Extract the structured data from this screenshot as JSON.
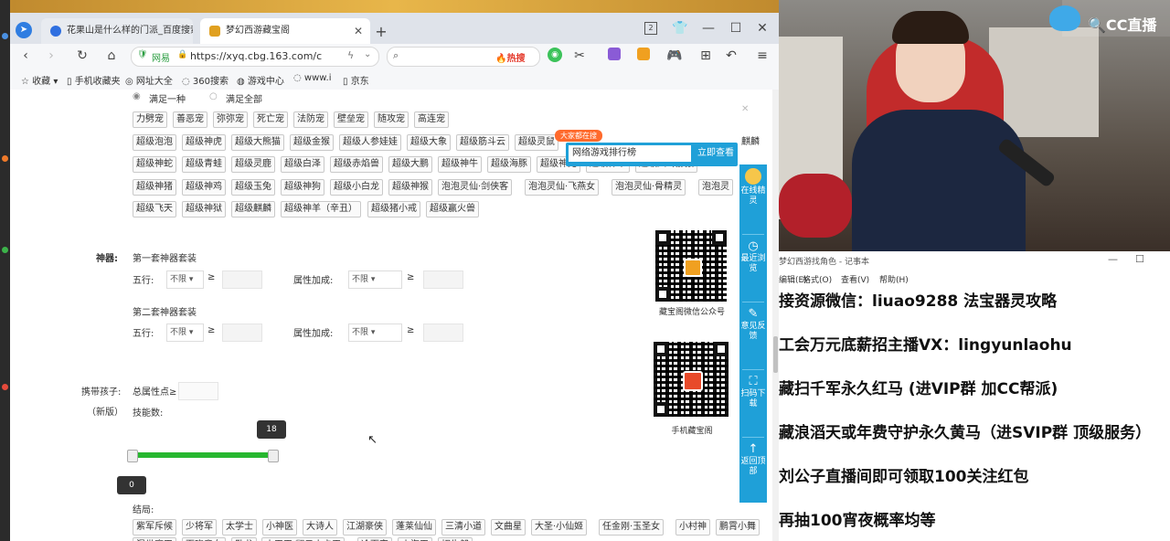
{
  "browser": {
    "tabs": [
      {
        "label": "花果山是什么样的门派_百度搜索",
        "active": false
      },
      {
        "label": "梦幻西游藏宝阁",
        "active": true
      }
    ],
    "window_badge": "2",
    "url_prefix": "网易",
    "url": "https://xyq.cbg.163.com/c",
    "search_hot": "热搜",
    "bookmarks": [
      "收藏",
      "手机收藏夹",
      "网址大全",
      "360搜索",
      "游戏中心",
      "www.i",
      "京东"
    ]
  },
  "page": {
    "radio_all_label": "满足一种",
    "radio_any_label": "满足全部",
    "pets_row1": [
      "力劈宠",
      "善恶宠",
      "弥弥宠",
      "死亡宠",
      "法防宠",
      "壁垒宠",
      "随攻宠",
      "高连宠"
    ],
    "pets_row2": [
      "超级泡泡",
      "超级神虎",
      "超级大熊猫",
      "超级金猴",
      "超级人参娃娃",
      "超级大象",
      "超级筋斗云",
      "超级灵鼠"
    ],
    "pets_row2_tail": "麒麟",
    "pets_row3": [
      "超级神蛇",
      "超级青蛙",
      "超级灵鹿",
      "超级白泽",
      "超级赤焰兽",
      "超级大鹏",
      "超级神牛",
      "超级海豚",
      "超级神兔",
      "超级神羊",
      "超级六耳猕猴",
      "超级土地公公"
    ],
    "pets_row4": [
      "超级神猪",
      "超级神鸡",
      "超级玉兔",
      "超级神狗",
      "超级小白龙",
      "超级神猴",
      "泡泡灵仙·剑侠客",
      "泡泡灵仙·飞燕女",
      "泡泡灵仙·骨精灵",
      "泡泡灵"
    ],
    "pets_row5": [
      "超级飞天",
      "超级神狱",
      "超级麒麟",
      "超级神羊（辛丑）",
      "超级猪小戒",
      "超级赢火兽"
    ],
    "shenqi_label": "神器:",
    "set1_title": "第一套神器套装",
    "set2_title": "第二套神器套装",
    "wuxing_label": "五行:",
    "wuxing_value": "不限",
    "attr_label": "属性加成:",
    "attr_value": "不限",
    "gte": "≥",
    "child_label_1": "携带孩子:",
    "child_label_2": "（新版）",
    "total_attr_label": "总属性点≥",
    "skill_count_label": "技能数:",
    "slider_min_label": "0",
    "slider_max_label": "18",
    "slider_level": 1.0,
    "ending_label": "结局:",
    "endings_row1": [
      "紫军斥候",
      "少将军",
      "太学士",
      "小神医",
      "大诗人",
      "江湖豪侠",
      "蓬莱仙仙",
      "三清小道",
      "文曲星",
      "大圣·小仙姬",
      "任金刚·玉圣女",
      "小村神",
      "鹏霄小舞"
    ],
    "endings_row2": [
      "混世魔王",
      "百晓童女",
      "卧龙",
      "小天王·翻云小卡王",
      "冷面宫",
      "小海王",
      "招牛郎"
    ]
  },
  "popup": {
    "badge": "大家都在搜",
    "query": "网络游戏排行榜",
    "button": "立即查看"
  },
  "qr": {
    "wechat_caption": "藏宝阁微信公众号",
    "app_caption": "手机藏宝阁"
  },
  "side_float": [
    "在线精灵",
    "最近浏览",
    "意见反馈",
    "扫码下载",
    "返回顶部"
  ],
  "overlay": {
    "brand": "CC直播"
  },
  "notepad": {
    "title": "梦幻西游找角色 - 记事本",
    "menu": [
      "编辑(E)",
      "格式(O)",
      "查看(V)",
      "帮助(H)"
    ],
    "lines": [
      "接资源微信：liuao9288 法宝器灵攻略",
      "工会万元底薪招主播VX：lingyunlaohu",
      "藏扫千军永久红马 (进VIP群 加CC帮派)",
      "藏浪滔天或年费守护永久黄马（进SVIP群 顶级服务）",
      "刘公子直播间即可领取100关注红包",
      "再抽100宵夜概率均等"
    ]
  },
  "colors": {
    "accent_blue": "#1fa0d8",
    "slider_green": "#27b72f",
    "hot_red": "#e43a2c",
    "popup_orange": "#ff6a2c"
  }
}
